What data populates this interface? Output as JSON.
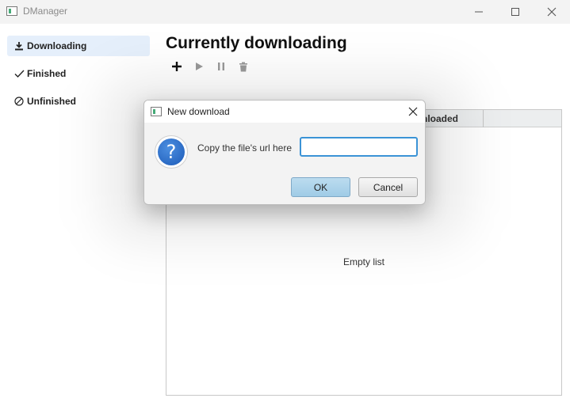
{
  "window": {
    "title": "DManager",
    "controls": [
      "minimize-icon",
      "maximize-icon",
      "close-icon"
    ]
  },
  "sidebar": {
    "items": [
      {
        "label": "Downloading",
        "icon": "download-icon",
        "active": true
      },
      {
        "label": "Finished",
        "icon": "checkmark-icon",
        "active": false
      },
      {
        "label": "Unfinished",
        "icon": "prohibited-icon",
        "active": false
      }
    ]
  },
  "main": {
    "title": "Currently downloading",
    "toolbar": [
      "add-icon",
      "play-icon",
      "pause-icon",
      "trash-icon"
    ],
    "list": {
      "visible_column_header": "nloaded",
      "empty_text": "Empty list"
    }
  },
  "dialog": {
    "title": "New download",
    "icon": "question-icon",
    "prompt": "Copy the file's url here",
    "input_value": "",
    "ok_label": "OK",
    "cancel_label": "Cancel"
  },
  "colors": {
    "active_sidebar": "#e5effb",
    "input_focus_border": "#3b93d6",
    "ok_button": "#a9d1ea",
    "question_icon": "#2a6fcf"
  }
}
